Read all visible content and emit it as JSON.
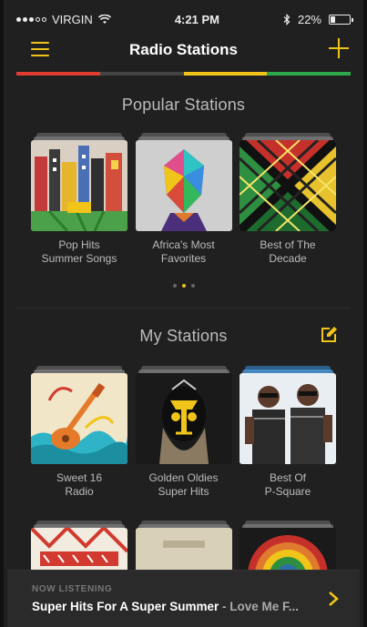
{
  "status_bar": {
    "carrier": "VIRGIN",
    "time": "4:21 PM",
    "battery": "22%",
    "icons": [
      "signal-dots-icon",
      "wifi-icon",
      "bluetooth-icon",
      "battery-icon"
    ]
  },
  "header": {
    "title": "Radio Stations",
    "left_icon": "menu-icon",
    "right_icon": "plus-icon"
  },
  "accent_colors": {
    "yellow": "#f0c419",
    "stripe": [
      "#e03c31",
      "#444444",
      "#f0c419",
      "#2ea84a"
    ]
  },
  "popular": {
    "title": "Popular Stations",
    "items": [
      {
        "line1": "Pop Hits",
        "line2": "Summer Songs"
      },
      {
        "line1": "Africa's Most",
        "line2": "Favorites"
      },
      {
        "line1": "Best of The",
        "line2": "Decade"
      }
    ],
    "pager": {
      "count": 3,
      "active": 2
    }
  },
  "my_stations": {
    "title": "My Stations",
    "edit_icon": "edit-icon",
    "items": [
      {
        "line1": "Sweet 16",
        "line2": "Radio"
      },
      {
        "line1": "Golden Oldies",
        "line2": "Super Hits"
      },
      {
        "line1": "Best Of",
        "line2": "P-Square"
      }
    ]
  },
  "now_listening": {
    "label": "NOW LISTENING",
    "title": "Super Hits For A Super Summer",
    "separator": " - ",
    "track": "Love Me F...",
    "icon": "chevron-right-icon"
  }
}
